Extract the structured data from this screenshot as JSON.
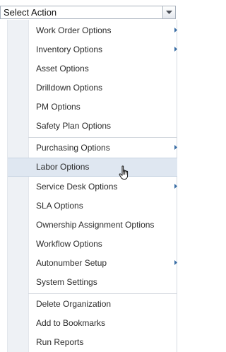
{
  "select": {
    "value": "Select Action"
  },
  "menu": {
    "items": [
      {
        "label": "Work Order Options"
      },
      {
        "label": "Inventory Options"
      },
      {
        "label": "Asset Options"
      },
      {
        "label": "Drilldown Options"
      },
      {
        "label": "PM Options"
      },
      {
        "label": "Safety Plan Options"
      },
      {
        "label": "Purchasing Options"
      },
      {
        "label": "Labor Options"
      },
      {
        "label": "Service Desk Options"
      },
      {
        "label": "SLA Options"
      },
      {
        "label": "Ownership Assignment Options"
      },
      {
        "label": "Workflow Options"
      },
      {
        "label": "Autonumber Setup"
      },
      {
        "label": "System Settings"
      },
      {
        "label": "Delete Organization"
      },
      {
        "label": "Add to Bookmarks"
      },
      {
        "label": "Run Reports"
      }
    ]
  },
  "colors": {
    "hover_bg": "#dfe7f1",
    "gutter_bg": "#eef1f5",
    "submenu_arrow": "#3a6ea5"
  },
  "icons": [
    "chevron-down-icon",
    "submenu-arrow-icon",
    "hand-cursor-icon"
  ]
}
